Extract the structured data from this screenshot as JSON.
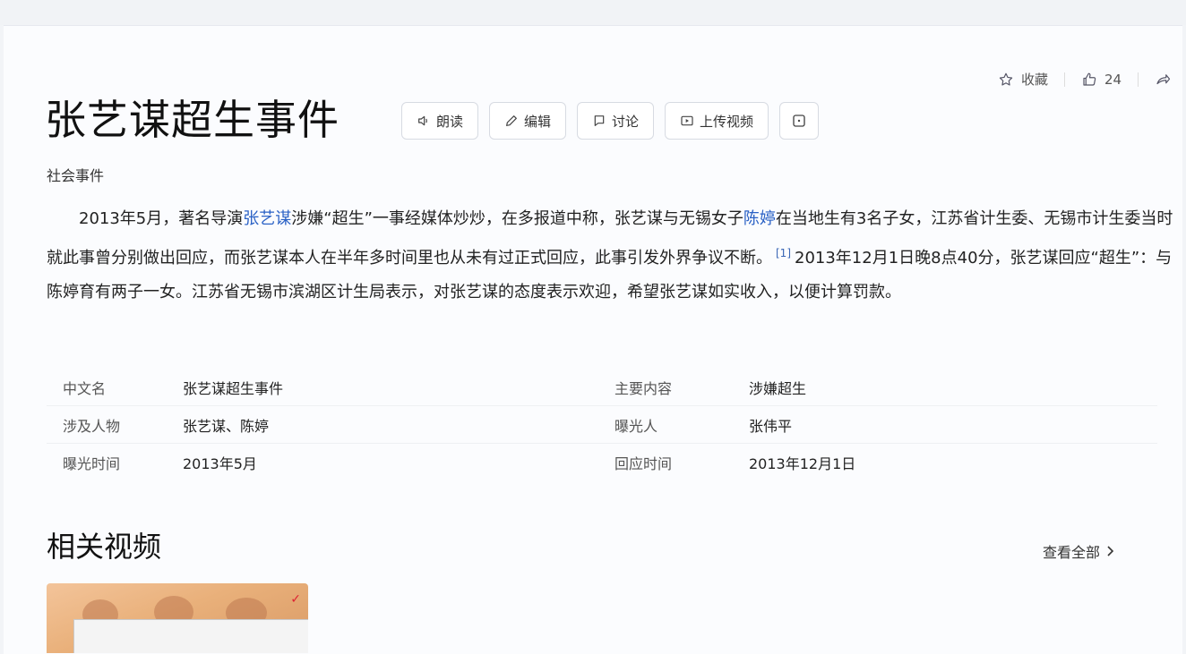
{
  "header": {
    "collect_label": "收藏",
    "like_count": "24"
  },
  "entry": {
    "title": "张艺谋超生事件",
    "subtitle": "社会事件"
  },
  "toolbar": {
    "play_label": "朗读",
    "edit_label": "编辑",
    "discuss_label": "讨论",
    "upload_label": "上传视频"
  },
  "summary": {
    "part1": "2013年5月，著名导演",
    "link1": "张艺谋",
    "part2": "涉嫌“超生”一事经媒体炒炒，在多报道中称，张艺谋与无锡女子",
    "link2": "陈婷",
    "part3": "在当地生有3名子女，江苏省计生委、无锡市计生委当时就此事曾分别做出回应，而张艺谋本人在半年多时间里也从未有过正式回应，此事引发外界争议不断。",
    "ref": "[1]",
    "part4": "2013年12月1日晚8点40分，张艺谋回应“超生”：与陈婷育有两子一女。江苏省无锡市滨湖区计生局表示，对张艺谋的态度表示欢迎，希望张艺谋如实收入，以便计算罚款。"
  },
  "info": {
    "rows": [
      {
        "k1": "中文名",
        "v1": "张艺谋超生事件",
        "k2": "主要内容",
        "v2": "涉嫌超生"
      },
      {
        "k1": "涉及人物",
        "v1": "张艺谋、陈婷",
        "k2": "曝光人",
        "v2": "张伟平"
      },
      {
        "k1": "曝光时间",
        "v1": "2013年5月",
        "k2": "回应时间",
        "v2": "2013年12月1日"
      }
    ]
  },
  "related": {
    "title": "相关视频",
    "view_all": "查看全部"
  },
  "colors": {
    "link": "#2a61c5",
    "border": "#d7dbe2"
  }
}
